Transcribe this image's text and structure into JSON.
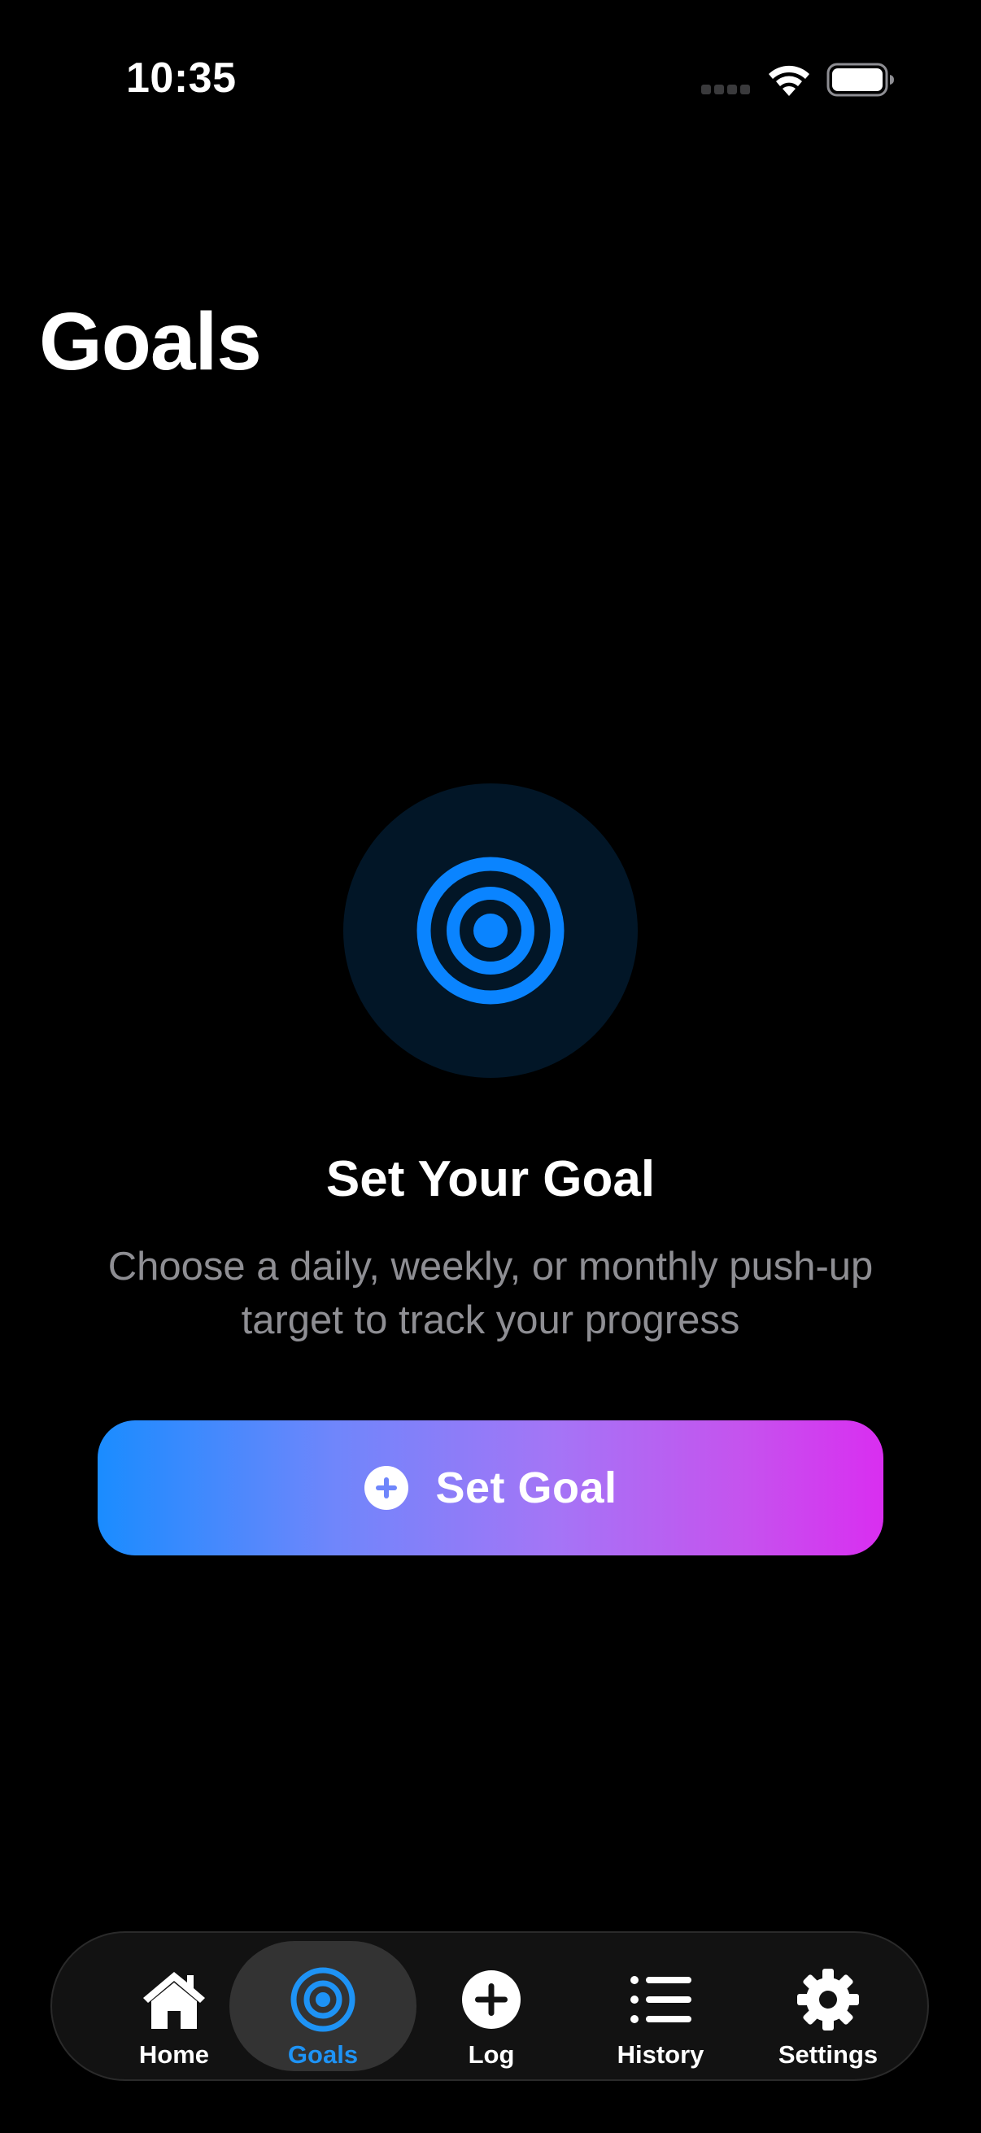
{
  "status_bar": {
    "time": "10:35"
  },
  "page": {
    "title": "Goals"
  },
  "empty_state": {
    "icon": "target-icon",
    "title": "Set Your Goal",
    "description": "Choose a daily, weekly, or monthly push-up target to track your progress"
  },
  "cta": {
    "label": "Set Goal",
    "icon": "plus-circle-icon"
  },
  "tabs": [
    {
      "label": "Home",
      "icon": "house-icon",
      "active": false
    },
    {
      "label": "Goals",
      "icon": "target-icon",
      "active": true
    },
    {
      "label": "Log",
      "icon": "plus-circle-icon",
      "active": false
    },
    {
      "label": "History",
      "icon": "list-icon",
      "active": false
    },
    {
      "label": "Settings",
      "icon": "gear-icon",
      "active": false
    }
  ],
  "colors": {
    "background": "#000000",
    "accent": "#0a84ff",
    "active_tab_label": "#1e93f5",
    "badge_background": "#021627",
    "gradient_start": "#1a8cff",
    "gradient_end": "#d92ef0",
    "secondary_text": "#8e8e93"
  }
}
